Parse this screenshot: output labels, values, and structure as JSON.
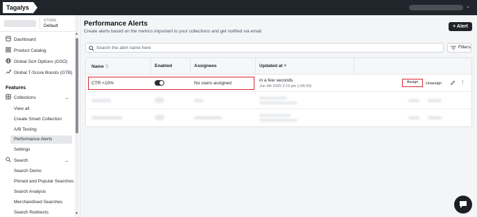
{
  "app": {
    "logo_text": "Tagalys"
  },
  "store": {
    "label": "STORE",
    "value": "Default"
  },
  "sidebar": {
    "main_items": [
      {
        "label": "Dashboard",
        "icon": "dashboard-icon"
      },
      {
        "label": "Product Catalog",
        "icon": "grid-icon"
      },
      {
        "label": "Global Sort Options (GSO)",
        "icon": "globe-icon"
      },
      {
        "label": "Global T-Score Boosts (GTB)",
        "icon": "trend-icon"
      }
    ],
    "features_heading": "Features",
    "collections": {
      "label": "Collections",
      "collapse_symbol": "−",
      "items": [
        "View all",
        "Create Smart Collection",
        "A/B Testing",
        "Performance Alerts",
        "Settings"
      ],
      "active_item": "Performance Alerts"
    },
    "search": {
      "label": "Search",
      "collapse_symbol": "−",
      "items": [
        "Search Demo",
        "Pinned and Popular Searches",
        "Search Analysis",
        "Merchandised Searches",
        "Search Redirects"
      ]
    }
  },
  "page": {
    "title": "Performance Alerts",
    "subtitle": "Create alerts based on the metrics important to your collections and get notified via email.",
    "add_button_label": "+ Alert"
  },
  "search_bar": {
    "placeholder": "Search the alert name here",
    "value": ""
  },
  "filters_button": {
    "label": "Filters"
  },
  "table": {
    "columns": [
      "Name",
      "Enabled",
      "Assignees",
      "Updated at"
    ],
    "rows": [
      {
        "name": "CTR <10%",
        "enabled": true,
        "assignees": "No users assigned",
        "updated_relative": "in a few seconds",
        "updated_absolute": "Jun 4th 2025 3:19 pm (+05:30)",
        "assign_label": "Assign",
        "unassign_label": "Unassign"
      }
    ],
    "blurred_row_count": 2
  },
  "colors": {
    "accent": "#1f2328",
    "highlight": "#d9232d",
    "topbar": "#20252b"
  }
}
